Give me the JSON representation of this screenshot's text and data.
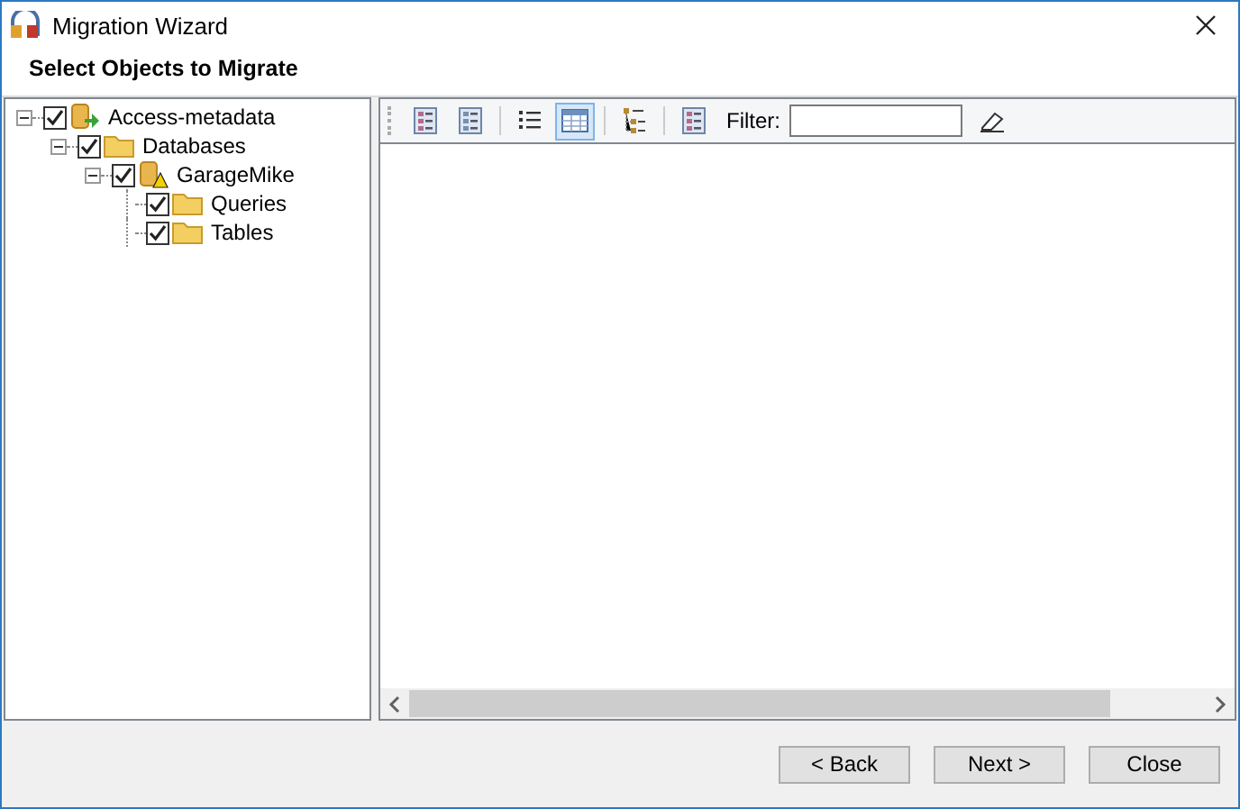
{
  "window": {
    "title": "Migration Wizard"
  },
  "heading": "Select Objects to Migrate",
  "tree": [
    {
      "label": "Access-metadata",
      "kind": "server",
      "checked": true,
      "expanded": true,
      "children": [
        {
          "label": "Databases",
          "kind": "folder",
          "checked": true,
          "expanded": true,
          "children": [
            {
              "label": "GarageMike",
              "kind": "database",
              "checked": true,
              "expanded": true,
              "children": [
                {
                  "label": "Queries",
                  "kind": "folder",
                  "checked": true
                },
                {
                  "label": "Tables",
                  "kind": "folder",
                  "checked": true
                }
              ]
            }
          ]
        }
      ]
    }
  ],
  "toolbar": {
    "buttons": [
      {
        "kind": "check-all"
      },
      {
        "kind": "uncheck-all"
      },
      {
        "kind": "list",
        "selected": false
      },
      {
        "kind": "grid",
        "selected": true
      },
      {
        "kind": "tree",
        "selected": false
      },
      {
        "kind": "check-all"
      }
    ],
    "filter_label": "Filter:"
  },
  "buttons": [
    "< Back",
    "Next >",
    "Close"
  ]
}
